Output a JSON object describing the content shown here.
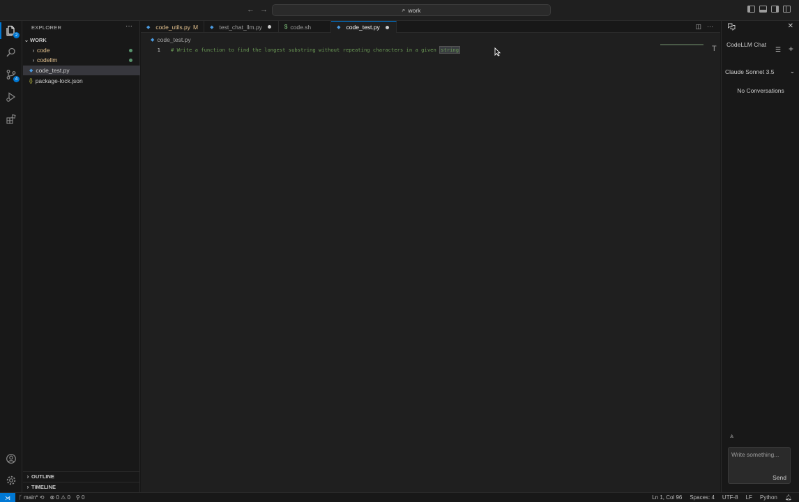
{
  "titlebar": {
    "search_text": "work",
    "back_glyph": "←",
    "forward_glyph": "→",
    "search_icon": "⌕"
  },
  "activity": {
    "explorer_badge": "2",
    "scm_badge": "4"
  },
  "sidebar": {
    "header": "EXPLORER",
    "more": "···",
    "root_folder": "WORK",
    "items": [
      {
        "label": "code",
        "type": "folder"
      },
      {
        "label": "codellm",
        "type": "folder"
      },
      {
        "label": "code_test.py",
        "type": "python"
      },
      {
        "label": "package-lock.json",
        "type": "json"
      }
    ],
    "json_glyph": "{}",
    "outline": "OUTLINE",
    "timeline": "TIMELINE"
  },
  "editor": {
    "tabs": [
      {
        "label": "code_utils.py",
        "status": "M"
      },
      {
        "label": "test_chat_llm.py"
      },
      {
        "label": "code.sh",
        "glyph": "$"
      },
      {
        "label": "code_test.py"
      }
    ],
    "breadcrumb": "code_test.py",
    "line_number": "1",
    "code_before": "# Write a function to find the longest substring without repeating characters in a given ",
    "code_highlight": "string",
    "scroll_glyph": "T"
  },
  "chat": {
    "title": "CodeLLM Chat",
    "model": "Claude Sonnet 3.5",
    "empty_state": "No Conversations",
    "input_placeholder": "Write something...",
    "send_label": "Send",
    "close_glyph": "✕",
    "plus_glyph": "+",
    "list_glyph": "☰",
    "chevron_glyph": "⌄",
    "agent_glyph": "⩓"
  },
  "statusbar": {
    "branch": "main*",
    "errors": "0",
    "warnings": "0",
    "ports": "0",
    "position": "Ln 1, Col 96",
    "spaces": "Spaces: 4",
    "encoding": "UTF-8",
    "eol": "LF",
    "language": "Python"
  },
  "colors": {
    "accent": "#0078d4",
    "comment": "#6a9955",
    "modified": "#e2c08d",
    "background": "#181818"
  }
}
